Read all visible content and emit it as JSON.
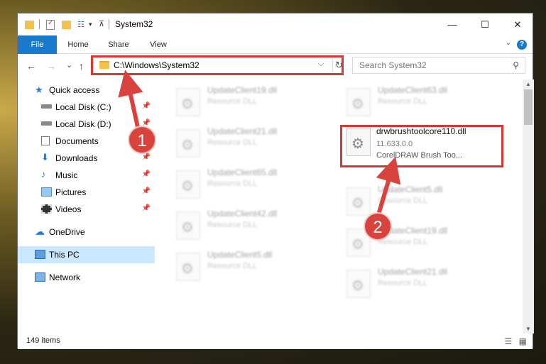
{
  "window": {
    "title": "System32",
    "controls": {
      "minimize": "—",
      "maximize": "☐",
      "close": "✕"
    }
  },
  "ribbon": {
    "tabs": [
      "File",
      "Home",
      "Share",
      "View"
    ],
    "help": "?"
  },
  "addressbar": {
    "path": "C:\\Windows\\System32",
    "dropdown": "⌵",
    "refresh": "↻"
  },
  "search": {
    "placeholder": "Search System32",
    "icon": "search-icon"
  },
  "navigation": {
    "back": "←",
    "forward": "→",
    "recent": "⌄",
    "up": "↑"
  },
  "sidebar": {
    "items": [
      {
        "label": "Quick access",
        "icon": "star-icon",
        "pinned": false
      },
      {
        "label": "Local Disk (C:)",
        "icon": "drive-icon",
        "pinned": true
      },
      {
        "label": "Local Disk (D:)",
        "icon": "drive-icon",
        "pinned": true
      },
      {
        "label": "Documents",
        "icon": "documents-icon",
        "pinned": true
      },
      {
        "label": "Downloads",
        "icon": "download-icon",
        "pinned": true
      },
      {
        "label": "Music",
        "icon": "music-icon",
        "pinned": true
      },
      {
        "label": "Pictures",
        "icon": "pictures-icon",
        "pinned": true
      },
      {
        "label": "Videos",
        "icon": "videos-icon",
        "pinned": true
      },
      {
        "label": "OneDrive",
        "icon": "cloud-icon",
        "pinned": false
      },
      {
        "label": "This PC",
        "icon": "computer-icon",
        "pinned": false,
        "selected": true
      },
      {
        "label": "Network",
        "icon": "network-icon",
        "pinned": false
      }
    ]
  },
  "files": {
    "left_column": [
      {
        "name": "UpdateClient19.dll",
        "type": "Resource DLL"
      },
      {
        "name": "UpdateClient21.dll",
        "type": "Resource DLL"
      },
      {
        "name": "UpdateClient65.dll",
        "type": "Resource DLL"
      },
      {
        "name": "UpdateClient42.dll",
        "type": "Resource DLL"
      },
      {
        "name": "UpdateClient5.dll",
        "type": "Resource DLL"
      }
    ],
    "right_column": [
      {
        "name": "UpdateClient63.dll",
        "type": "Resource DLL"
      },
      {
        "name": "UpdateClient5.dll",
        "type": "Resource DLL"
      },
      {
        "name": "UpdateClient19.dll",
        "type": "Resource DLL"
      },
      {
        "name": "UpdateClient21.dll",
        "type": "Resource DLL"
      }
    ],
    "highlighted": {
      "name": "drwbrushtoolcore110.dll",
      "version": "11.633.0.0",
      "description": "CorelDRAW Brush Too..."
    }
  },
  "status": {
    "item_count": "149 items"
  },
  "callouts": [
    "1",
    "2"
  ],
  "colors": {
    "accent": "#1979ca",
    "highlight": "#d13a35",
    "selection": "#cce8ff"
  }
}
